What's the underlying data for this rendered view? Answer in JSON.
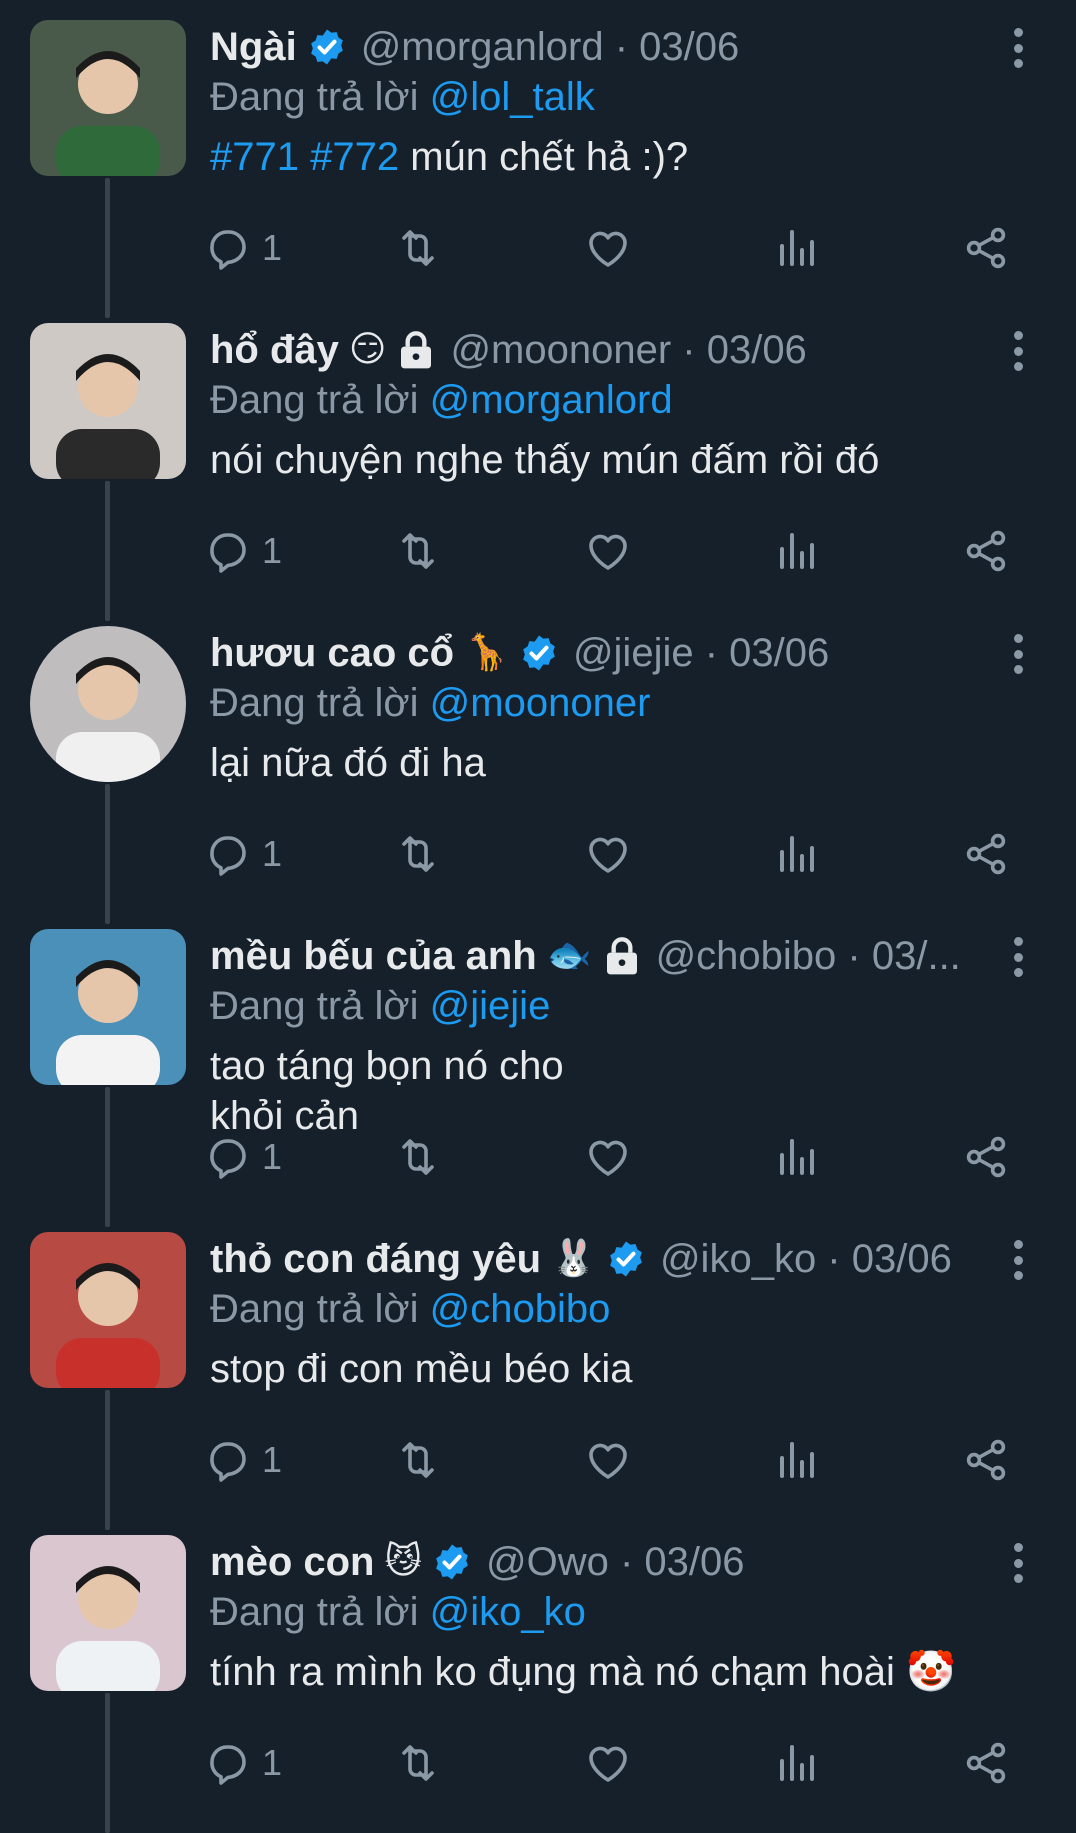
{
  "colors": {
    "background": "#15202b",
    "text": "#e7e9ea",
    "muted": "#8b98a5",
    "accent": "#1d9bf0",
    "line": "#38444d"
  },
  "replying_prefix": "Đang trả lời",
  "tweets": [
    {
      "name": "Ngài",
      "emoji": "",
      "verified": true,
      "locked": false,
      "handle": "@morganlord · 03/06",
      "replying_to": "@lol_talk",
      "hashtags": "#771 #772",
      "text": " mún chết hả :)?",
      "reply_count": "1",
      "avatar_color": "#4a5a4a"
    },
    {
      "name": "hổ đây",
      "emoji": "😏",
      "verified": false,
      "locked": true,
      "handle": "@moononer · 03/06",
      "replying_to": "@morganlord",
      "hashtags": "",
      "text": "nói chuyện nghe thấy mún đấm rồi đó",
      "reply_count": "1",
      "avatar_color": "#cfc9c6"
    },
    {
      "name": "hươu cao cổ",
      "emoji": "🦒",
      "verified": true,
      "locked": false,
      "handle": "@jiejie · 03/06",
      "replying_to": "@moononer",
      "hashtags": "",
      "text": "lại nữa đó đi ha",
      "reply_count": "1",
      "avatar_color": "#bfbdbd"
    },
    {
      "name": "mều bếu của anh",
      "emoji": "🐟",
      "verified": false,
      "locked": true,
      "handle": "@chobibo · 03/...",
      "replying_to": "@jiejie",
      "hashtags": "",
      "text": "tao táng bọn nó cho\nkhỏi cản",
      "reply_count": "1",
      "avatar_color": "#4b90b8"
    },
    {
      "name": "thỏ con đáng yêu",
      "emoji": "🐰",
      "verified": true,
      "locked": false,
      "handle": "@iko_ko · 03/06",
      "replying_to": "@chobibo",
      "hashtags": "",
      "text": "stop đi con mều béo kia",
      "reply_count": "1",
      "avatar_color": "#b84a44"
    },
    {
      "name": "mèo con",
      "emoji": "😼",
      "verified": true,
      "locked": false,
      "handle": "@Owo · 03/06",
      "replying_to": "@iko_ko",
      "hashtags": "",
      "text": "tính ra mình ko đụng mà nó chạm hoài 🤡",
      "reply_count": "1",
      "avatar_color": "#d9c6cf"
    }
  ]
}
